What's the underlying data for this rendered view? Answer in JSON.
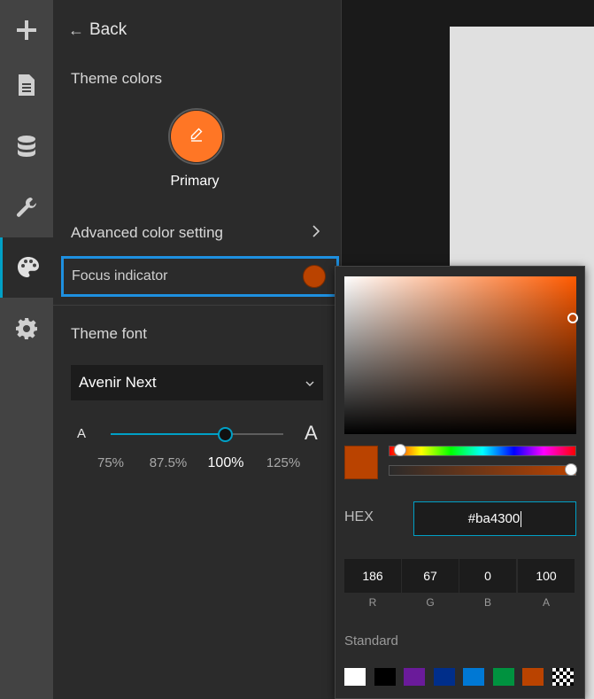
{
  "rail": {
    "items": [
      {
        "icon": "plus-icon"
      },
      {
        "icon": "page-icon"
      },
      {
        "icon": "data-icon"
      },
      {
        "icon": "wrench-icon"
      },
      {
        "icon": "palette-icon",
        "active": true
      },
      {
        "icon": "gear-icon"
      }
    ]
  },
  "panel": {
    "back_label": "Back",
    "theme_colors_label": "Theme colors",
    "primary_label": "Primary",
    "primary_color": "#ff7625",
    "advanced_label": "Advanced color setting",
    "focus_label": "Focus indicator",
    "focus_color": "#ba4300",
    "theme_font_label": "Theme font",
    "font_value": "Avenir Next",
    "font_size": {
      "small_glyph": "A",
      "large_glyph": "A",
      "ticks": [
        "75%",
        "87.5%",
        "100%",
        "125%"
      ],
      "selected": "100%",
      "slider_position_fraction": 0.66
    }
  },
  "picker": {
    "hex_label": "HEX",
    "hex_value": "#ba4300",
    "channels": [
      {
        "label": "R",
        "value": "186"
      },
      {
        "label": "G",
        "value": "67"
      },
      {
        "label": "B",
        "value": "0"
      },
      {
        "label": "A",
        "value": "100"
      }
    ],
    "standard_label": "Standard",
    "standard_colors": [
      "#ffffff",
      "#000000",
      "#6a1b9a",
      "#002e8a",
      "#0078d4",
      "#00923f",
      "#ba4300",
      "transparent"
    ]
  },
  "colors": {
    "accent": "#00a0c6",
    "focus_outline": "#1e90e0"
  }
}
